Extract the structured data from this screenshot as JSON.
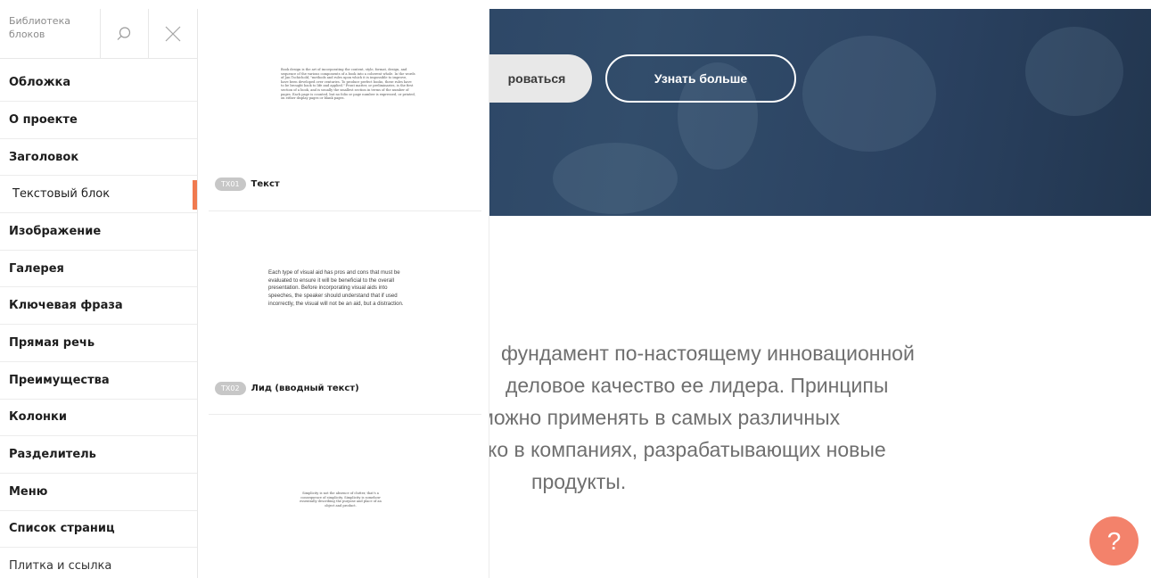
{
  "library": {
    "title": "Библиотека блоков",
    "icons": {
      "search": "search-icon",
      "close": "close-icon"
    },
    "items": [
      {
        "label": "Обложка"
      },
      {
        "label": "О проекте"
      },
      {
        "label": "Заголовок"
      },
      {
        "label": "Текстовый блок",
        "active": true
      },
      {
        "label": "Изображение"
      },
      {
        "label": "Галерея"
      },
      {
        "label": "Ключевая фраза"
      },
      {
        "label": "Прямая речь"
      },
      {
        "label": "Преимущества"
      },
      {
        "label": "Колонки"
      },
      {
        "label": "Разделитель"
      },
      {
        "label": "Меню"
      },
      {
        "label": "Список страниц"
      },
      {
        "label": "Плитка и ссылка"
      }
    ],
    "accent_color": "#f07a4f"
  },
  "previews": [
    {
      "sample_text": "Book design is the art of incorporating the content, style, format, design, and sequence of the various components of a book into a coherent whole. In the words of Jan Tschichold, \"methods and rules upon which it is impossible to improve, have been developed over centuries. To produce perfect books, these rules have to be brought back to life and applied.\" Front matter, or preliminaries, is the first section of a book, and is usually the smallest section in terms of the number of pages. Each page is counted, but no folio or page number is expressed, or printed, on either display pages or blank pages.",
      "code": "TX01",
      "name": "Текст"
    },
    {
      "sample_text": "Each type of visual aid has pros and cons that must be evaluated to ensure it will be beneficial to the overall presentation. Before incorporating visual aids into speeches, the speaker should understand that if used incorrectly, the visual will not be an aid, but a distraction.",
      "code": "TX02",
      "name": "Лид (вводный текст)"
    },
    {
      "sample_text": "Simplicity is not the absence of clutter, that's a consequence of simplicity. Simplicity is somehow essentially describing the purpose and place of an object and product."
    }
  ],
  "page": {
    "hero": {
      "primary_button": "рoваться",
      "secondary_button": "Узнать больше",
      "background_color": "#2c4565"
    },
    "body_lines": [
      "фундамент по-настоящему инновационной",
      "деловое качество ее лидера. Принципы",
      "можно применять в самых различных",
      "ко в компаниях, разрабатывающих новые",
      "продукты."
    ],
    "help": {
      "label": "?",
      "color": "#f3826b"
    }
  }
}
